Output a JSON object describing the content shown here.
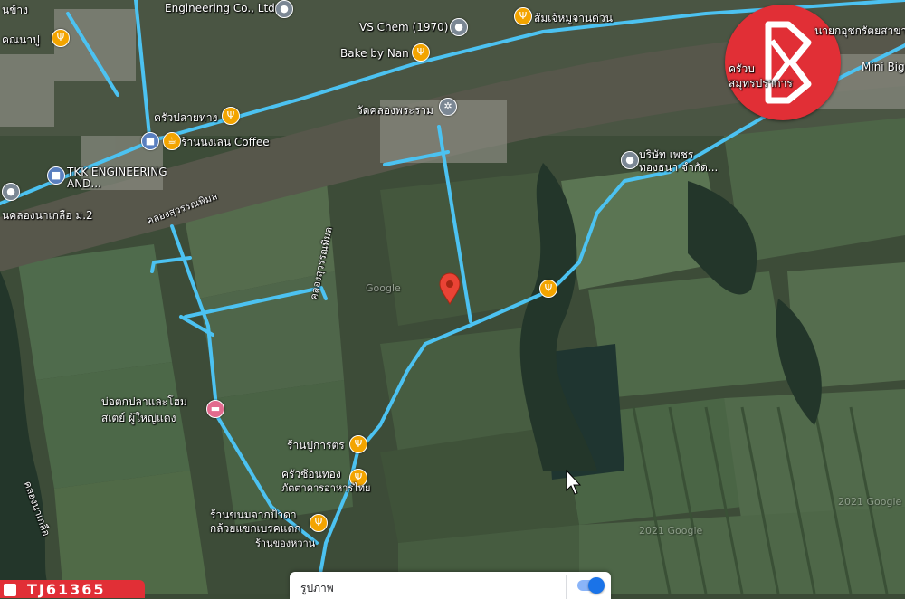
{
  "map": {
    "labels": {
      "engineering": "Engineering Co., Ltd",
      "vs_chem": "VS Chem (1970)",
      "restaurant_top": "ส้มเจ้หมูจานด่วน",
      "bake_by_nan": "Bake by Nan",
      "temple": "วัดคลองพระราม",
      "krua_plai_thang": "ครัวปลายทาง",
      "coffee": "ร้านนงเลน Coffee",
      "tkk_1": "TKK ENGINEERING",
      "tkk_2": "AND...",
      "village": "นคลองนาเกลือ ม.2",
      "company_1": "บริษัท เพชร",
      "company_2": "ทองธนา จำกัด...",
      "fish_pond_1": "บ่อตกปลาและโฮม",
      "fish_pond_2": "สเตย์ ผู้ใหญ่แดง",
      "ran_pu": "ร้านปูการตร",
      "krua_son_1": "ครัวซ้อนทอง",
      "krua_son_2": "ภัตตาคารอาหารไทย",
      "khanom_1": "ร้านขนมจากป้าดา",
      "khanom_2": "กล้วยแขกเบรคแตก",
      "khanom_3": "ร้านของหวาน",
      "canal_1": "คลองสุวรรณพิมล",
      "canal_2": "คลองสุวรรณพิมล",
      "top_left_1": "นข้าง",
      "top_left_2": "คณนาปู",
      "top_right_1": "นายกอุชกรัตยสาขา",
      "top_right_2": "ครัวบ",
      "top_right_3": "สมุทรปราการ",
      "mini_big": "Mini Big",
      "canal_left": "คลองนาเกลือ",
      "copyright_1": "2021 Google",
      "copyright_2": "2021 Google",
      "watermark": "Google"
    }
  },
  "ui": {
    "layer_toggle_label": "รูปภาพ",
    "listing_code": "TJ61365"
  },
  "colors": {
    "road": "#4cc2f1",
    "river": "#5a5a4e",
    "pin_red": "#ea4335",
    "food_pin": "#f4a30b",
    "brand_red": "#e12f36"
  }
}
